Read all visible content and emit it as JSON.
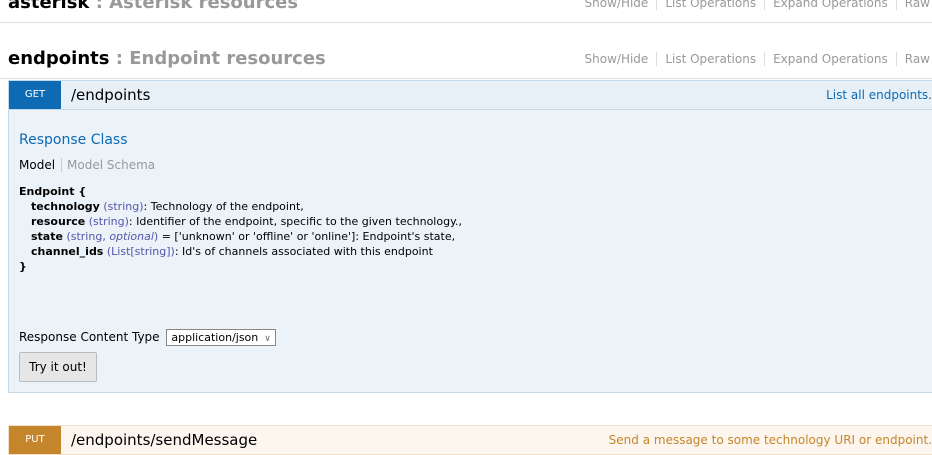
{
  "resources": [
    {
      "name": "asterisk",
      "description": ": Asterisk resources"
    },
    {
      "name": "endpoints",
      "description": ": Endpoint resources"
    }
  ],
  "resource_links": [
    "Show/Hide",
    "List Operations",
    "Expand Operations",
    "Raw"
  ],
  "get_op": {
    "method": "GET",
    "path": "/endpoints",
    "summary": "List all endpoints."
  },
  "response_class": {
    "title": "Response Class",
    "tab_model": "Model",
    "tab_schema": "Model Schema",
    "model_name": "Endpoint {",
    "closing": "}",
    "fields": [
      {
        "name": "technology",
        "type": "(string)",
        "desc": ": Technology of the endpoint,"
      },
      {
        "name": "resource",
        "type": "(string)",
        "desc": ": Identifier of the endpoint, specific to the given technology.,"
      },
      {
        "name": "state",
        "type_a": "(string, ",
        "type_opt": "optional",
        "type_b": ")",
        "desc": " = ['unknown' or 'offline' or 'online']: Endpoint's state,"
      },
      {
        "name": "channel_ids",
        "type": "(List[string])",
        "desc": ": Id's of channels associated with this endpoint"
      }
    ]
  },
  "response_content_type": {
    "label": "Response Content Type",
    "selected": "application/json"
  },
  "try_button": "Try it out!",
  "put_op": {
    "method": "PUT",
    "path": "/endpoints/sendMessage",
    "summary": "Send a message to some technology URI or endpoint."
  },
  "colors": {
    "get": "#0f6ab4",
    "put": "#c5862b"
  }
}
